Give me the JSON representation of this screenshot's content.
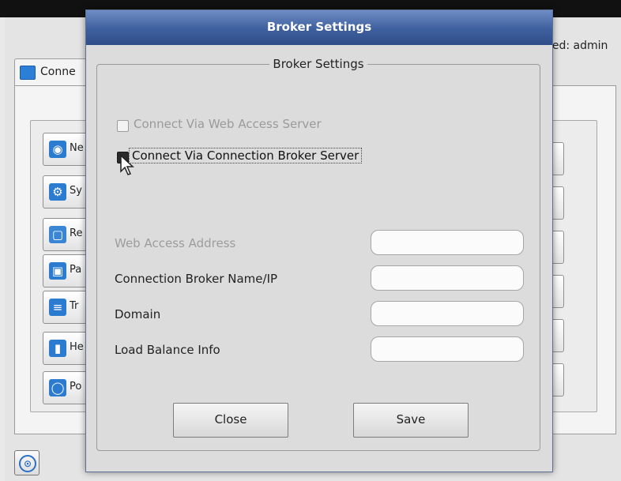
{
  "background": {
    "logged_text": "ged: admin",
    "tab_label": "Conne",
    "side_items": [
      {
        "icon": "network-icon",
        "label": "Ne",
        "color": "#2b7bd1"
      },
      {
        "icon": "system-gear-icon",
        "label": "Sy",
        "color": "#2b7bd1"
      },
      {
        "icon": "remote-desktop-icon",
        "label": "Re",
        "color": "#3b86d4"
      },
      {
        "icon": "lock-icon",
        "label": "Pa",
        "color": "#2b7bd1"
      },
      {
        "icon": "troubleshoot-icon",
        "label": "Tr",
        "color": "#2b7bd1"
      },
      {
        "icon": "help-icon",
        "label": "He",
        "color": "#2b7bd1"
      },
      {
        "icon": "power-icon",
        "label": "Po",
        "color": "#2b7bd1"
      }
    ]
  },
  "dialog": {
    "title": "Broker Settings",
    "group_title": "Broker Settings",
    "checkboxes": [
      {
        "label": "Connect Via Web Access Server",
        "checked": false,
        "enabled": false
      },
      {
        "label": "Connect Via Connection Broker Server",
        "checked": true,
        "enabled": true
      }
    ],
    "fields": [
      {
        "label": "Web Access Address",
        "value": "",
        "enabled": false
      },
      {
        "label": "Connection Broker Name/IP",
        "value": "",
        "enabled": true
      },
      {
        "label": "Domain",
        "value": "",
        "enabled": true
      },
      {
        "label": "Load Balance Info",
        "value": "",
        "enabled": true
      }
    ],
    "buttons": {
      "close": "Close",
      "save": "Save"
    }
  },
  "colors": {
    "title_bar": "#3e5f9e",
    "accent": "#2b7bd1"
  }
}
